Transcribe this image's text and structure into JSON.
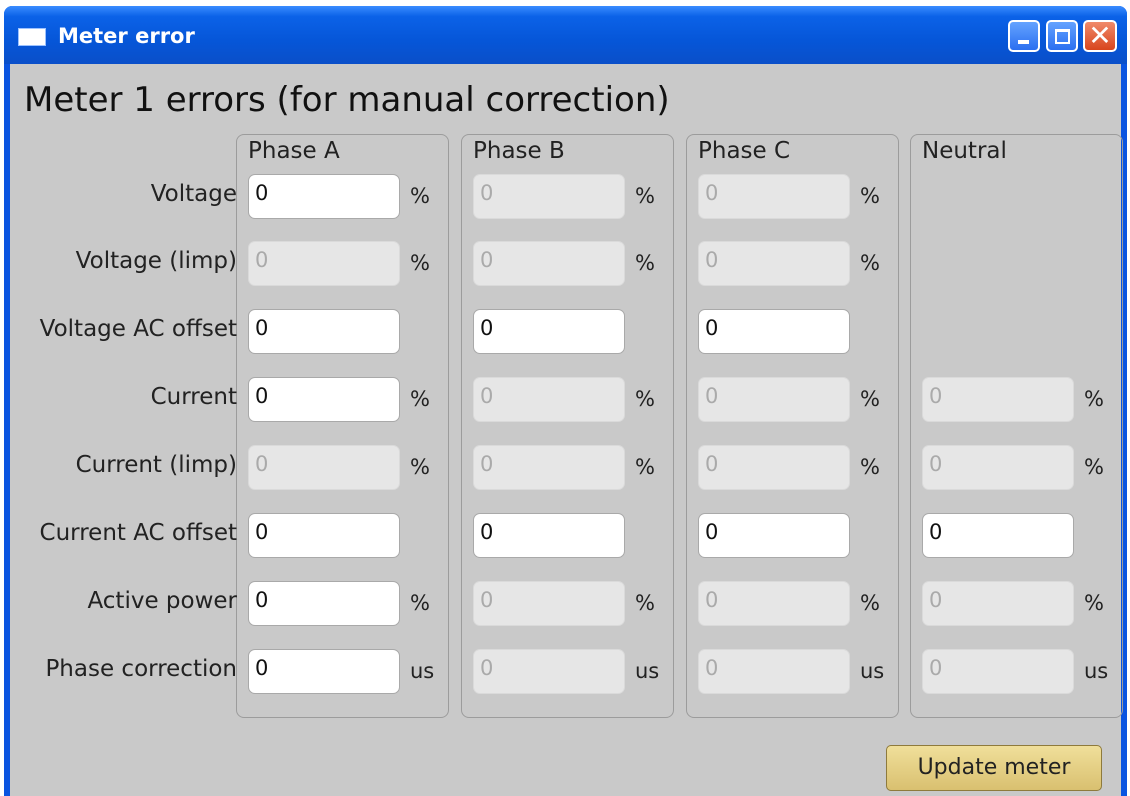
{
  "window": {
    "title": "Meter error"
  },
  "heading": "Meter 1 errors (for manual correction)",
  "columns": [
    "Phase A",
    "Phase B",
    "Phase C",
    "Neutral"
  ],
  "rows": [
    {
      "label": "Voltage",
      "cells": [
        {
          "value": "0",
          "enabled": true,
          "unit": "%"
        },
        {
          "value": "0",
          "enabled": false,
          "unit": "%"
        },
        {
          "value": "0",
          "enabled": false,
          "unit": "%"
        },
        null
      ]
    },
    {
      "label": "Voltage (limp)",
      "cells": [
        {
          "value": "0",
          "enabled": false,
          "unit": "%"
        },
        {
          "value": "0",
          "enabled": false,
          "unit": "%"
        },
        {
          "value": "0",
          "enabled": false,
          "unit": "%"
        },
        null
      ]
    },
    {
      "label": "Voltage AC offset",
      "cells": [
        {
          "value": "0",
          "enabled": true,
          "unit": ""
        },
        {
          "value": "0",
          "enabled": true,
          "unit": ""
        },
        {
          "value": "0",
          "enabled": true,
          "unit": ""
        },
        null
      ]
    },
    {
      "label": "Current",
      "cells": [
        {
          "value": "0",
          "enabled": true,
          "unit": "%"
        },
        {
          "value": "0",
          "enabled": false,
          "unit": "%"
        },
        {
          "value": "0",
          "enabled": false,
          "unit": "%"
        },
        {
          "value": "0",
          "enabled": false,
          "unit": "%"
        }
      ]
    },
    {
      "label": "Current (limp)",
      "cells": [
        {
          "value": "0",
          "enabled": false,
          "unit": "%"
        },
        {
          "value": "0",
          "enabled": false,
          "unit": "%"
        },
        {
          "value": "0",
          "enabled": false,
          "unit": "%"
        },
        {
          "value": "0",
          "enabled": false,
          "unit": "%"
        }
      ]
    },
    {
      "label": "Current AC offset",
      "cells": [
        {
          "value": "0",
          "enabled": true,
          "unit": ""
        },
        {
          "value": "0",
          "enabled": true,
          "unit": ""
        },
        {
          "value": "0",
          "enabled": true,
          "unit": ""
        },
        {
          "value": "0",
          "enabled": true,
          "unit": ""
        }
      ]
    },
    {
      "label": "Active power",
      "cells": [
        {
          "value": "0",
          "enabled": true,
          "unit": "%"
        },
        {
          "value": "0",
          "enabled": false,
          "unit": "%"
        },
        {
          "value": "0",
          "enabled": false,
          "unit": "%"
        },
        {
          "value": "0",
          "enabled": false,
          "unit": "%"
        }
      ]
    },
    {
      "label": "Phase correction",
      "cells": [
        {
          "value": "0",
          "enabled": true,
          "unit": "us"
        },
        {
          "value": "0",
          "enabled": false,
          "unit": "us"
        },
        {
          "value": "0",
          "enabled": false,
          "unit": "us"
        },
        {
          "value": "0",
          "enabled": false,
          "unit": "us"
        }
      ]
    }
  ],
  "update_button": "Update meter"
}
